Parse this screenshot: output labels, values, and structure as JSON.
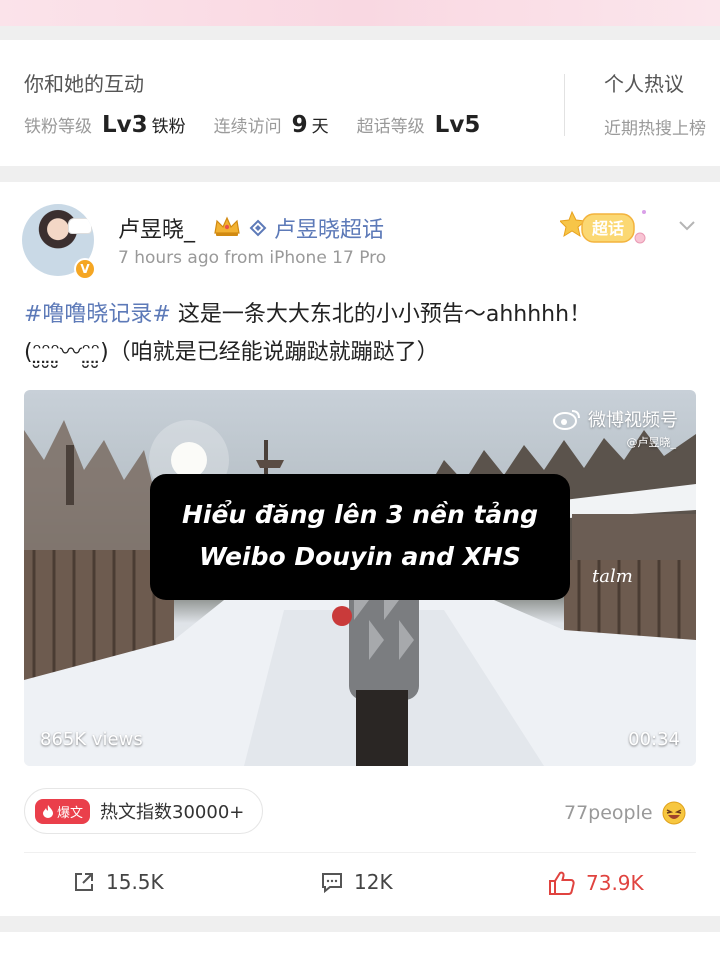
{
  "interaction": {
    "title": "你和她的互动",
    "iron_fan_label": "铁粉等级",
    "iron_fan_level": "Lv3",
    "iron_fan_unit": "铁粉",
    "visit_label": "连续访问",
    "visit_days": "9",
    "visit_unit": "天",
    "supertopic_label": "超话等级",
    "supertopic_level": "Lv5",
    "personal_title": "个人热议",
    "personal_sub": "近期热搜上榜"
  },
  "post": {
    "username": "卢昱晓_",
    "supertopic": "卢昱晓超话",
    "time_source": "7 hours ago  from iPhone 17 Pro",
    "badge_label": "超话",
    "hashtag": "#噜噜晓记录#",
    "text_line1_rest": " 这是一条大大东北的小小预告～ahhhhh！",
    "text_line2": "(ᵔ̤̮ᵔ̤̮ᵔ̤̮〰ᵔ̤̮ᵔ̤̮)（咱就是已经能说蹦跶就蹦跶了）",
    "video": {
      "watermark": "微博视频号",
      "watermark_handle": "@卢昱晓_",
      "caption_line1": "Hiểu đăng lên 3 nền tảng",
      "caption_line2": "Weibo Douyin and XHS",
      "overlay_sign": "talm",
      "views": "865K views",
      "duration": "00:34"
    },
    "hot_tag": "爆文",
    "hot_text": "热文指数30000+",
    "people": "77people",
    "shares": "15.5K",
    "comments": "12K",
    "likes": "73.9K"
  },
  "colors": {
    "link": "#5d7ab8",
    "like": "#e0433f",
    "hot": "#ea3f4b"
  }
}
